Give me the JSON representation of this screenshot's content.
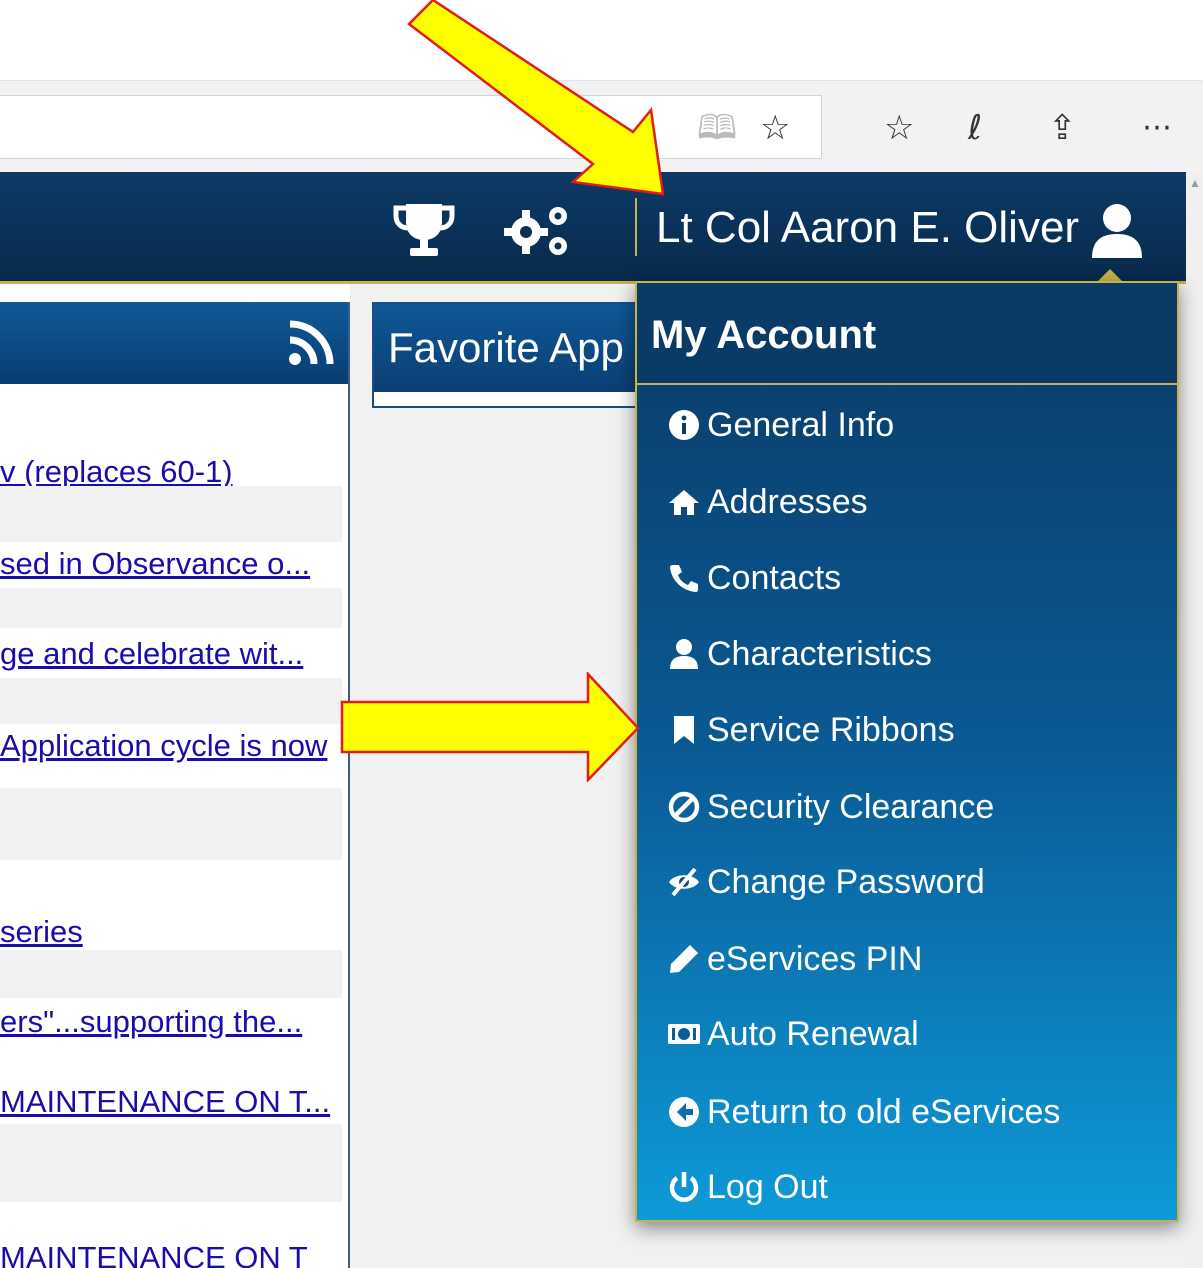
{
  "browser": {
    "icons": [
      "reading-view-icon",
      "star-icon",
      "favorites-icon",
      "pen-icon",
      "share-icon",
      "more-icon"
    ]
  },
  "header": {
    "user_name": "Lt Col Aaron E. Oliver",
    "icons": [
      "trophy-icon",
      "gears-icon",
      "user-icon"
    ]
  },
  "news": {
    "items": [
      "v (replaces 60-1)",
      "sed in Observance o...",
      "ge and celebrate wit...",
      "Application cycle is now",
      "series",
      "ers\"...supporting the...",
      "MAINTENANCE ON T...",
      "MAINTENANCE ON T"
    ]
  },
  "favorites": {
    "title": "Favorite App"
  },
  "account_menu": {
    "title": "My Account",
    "items": [
      {
        "label": "General Info",
        "icon": "info-icon"
      },
      {
        "label": "Addresses",
        "icon": "home-icon"
      },
      {
        "label": "Contacts",
        "icon": "phone-icon"
      },
      {
        "label": "Characteristics",
        "icon": "user-icon"
      },
      {
        "label": "Service Ribbons",
        "icon": "bookmark-icon"
      },
      {
        "label": "Security Clearance",
        "icon": "ban-icon"
      },
      {
        "label": "Change Password",
        "icon": "eye-slash-icon"
      },
      {
        "label": "eServices PIN",
        "icon": "pencil-icon"
      },
      {
        "label": "Auto Renewal",
        "icon": "money-icon"
      },
      {
        "label": "Return to old eServices",
        "icon": "arrow-left-circle-icon"
      },
      {
        "label": "Log Out",
        "icon": "power-icon"
      }
    ]
  },
  "colors": {
    "nav_bg": "#0c3a66",
    "accent_gold": "#c9b24a",
    "menu_gradient_top": "#0a3a66",
    "menu_gradient_bottom": "#0d9ad8",
    "annotation_arrow": "#ffff00",
    "annotation_arrow_outline": "#e21b1b",
    "link": "#1a0dab"
  }
}
